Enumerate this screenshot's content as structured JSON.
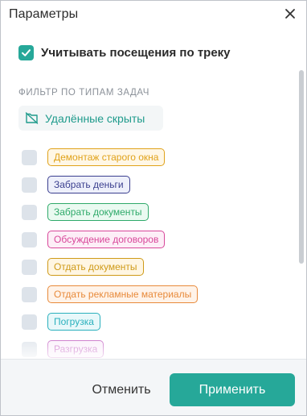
{
  "dialog": {
    "title": "Параметры",
    "close_icon": "close-icon"
  },
  "track_visits": {
    "label": "Учитывать посещения по треку",
    "checked": true,
    "accent": "#26a899"
  },
  "filter": {
    "section_title": "ФИЛЬТР ПО ТИПАМ ЗАДАЧ",
    "hidden_deleted_label": "Удалённые скрыты",
    "hidden_deleted_icon": "hidden-folder-icon",
    "tasks": [
      {
        "label": "Демонтаж старого окна",
        "color": "#e0a21a",
        "bg": "#fff7e6",
        "checked": false
      },
      {
        "label": "Забрать деньги",
        "color": "#3b3f8f",
        "bg": "#eef0fb",
        "checked": false
      },
      {
        "label": "Забрать документы",
        "color": "#2faa6a",
        "bg": "#eafaf1",
        "checked": false
      },
      {
        "label": "Обсуждение договоров",
        "color": "#d8479a",
        "bg": "#fdeef7",
        "checked": false
      },
      {
        "label": "Отдать документы",
        "color": "#cf9a18",
        "bg": "#fff6e3",
        "checked": false
      },
      {
        "label": "Отдать рекламные материалы",
        "color": "#e88a3a",
        "bg": "#fff3e9",
        "checked": false
      },
      {
        "label": "Погрузка",
        "color": "#2ab0bd",
        "bg": "#e8f8fa",
        "checked": false
      },
      {
        "label": "Разгрузка",
        "color": "#c05abf",
        "bg": "#faeefa",
        "checked": false
      }
    ]
  },
  "footer": {
    "cancel_label": "Отменить",
    "apply_label": "Применить",
    "apply_color": "#26a899"
  }
}
